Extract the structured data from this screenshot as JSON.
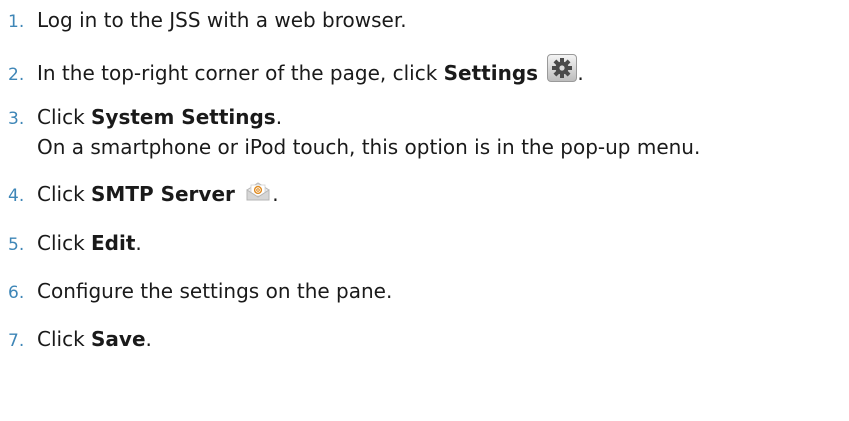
{
  "steps": [
    {
      "num": "1.",
      "text": "Log in to the JSS with a web browser."
    },
    {
      "num": "2.",
      "pre": "In the top-right corner of the page, click ",
      "bold": "Settings",
      "icon": "gear-icon",
      "post": "."
    },
    {
      "num": "3.",
      "pre": "Click ",
      "bold": "System Settings",
      "post": ".",
      "sub": "On a smartphone or iPod touch, this option is in the pop-up menu."
    },
    {
      "num": "4.",
      "pre": "Click ",
      "bold": "SMTP Server",
      "icon": "mail-icon",
      "post": "."
    },
    {
      "num": "5.",
      "pre": "Click ",
      "bold": "Edit",
      "post": "."
    },
    {
      "num": "6.",
      "text": "Configure the settings on the pane."
    },
    {
      "num": "7.",
      "pre": "Click ",
      "bold": "Save",
      "post": "."
    }
  ]
}
